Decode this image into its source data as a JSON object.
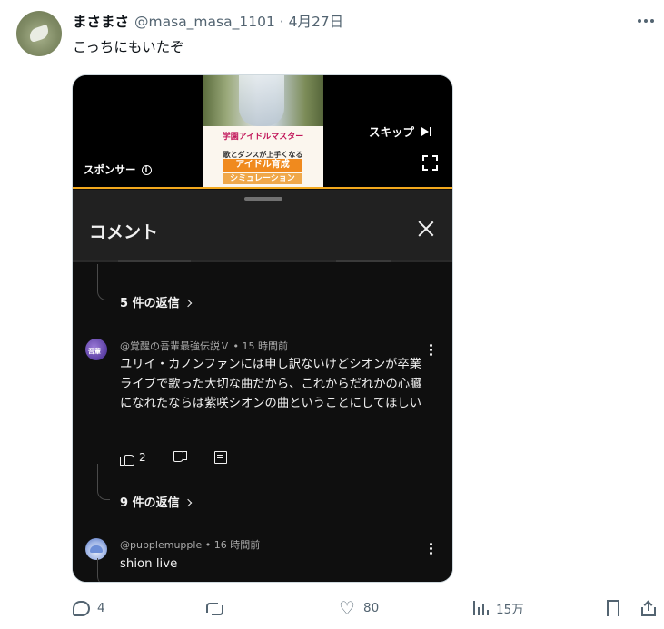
{
  "tweet": {
    "display_name": "まさまさ",
    "handle_and_time": "@masa_masa_1101 · 4月27日",
    "text": "こっちにもいたぞ",
    "avatar_icon": "user-avatar",
    "more_icon": "more-dots-icon"
  },
  "video_ad": {
    "thumbnail_logo": "学園アイドルマスター",
    "thumbnail_line1": "歌とダンスが上手くなる",
    "thumbnail_line2": "アイドル育成",
    "thumbnail_line3": "シミュレーション",
    "sponsor_label": "スポンサー",
    "sponsor_info_glyph": "i",
    "skip_label": "スキップ",
    "progress_color": "#f2a81d"
  },
  "comments_panel": {
    "title": "コメント",
    "close_icon": "close-icon",
    "thread1_replies": "5 件の返信",
    "comments": [
      {
        "author": "@覚醒の吾輩最強伝説Ｖ",
        "time": "15 時間前",
        "avatar_text": "吾輩",
        "text": "ユリイ・カノンファンには申し訳ないけどシオンが卒業ライブで歌った大切な曲だから、これからだれかの心臓になれたならは紫咲シオンの曲ということにしてほしい",
        "likes": "2",
        "replies": "9 件の返信"
      },
      {
        "author": "@pupplemupple",
        "time": "16 時間前",
        "text": "shion live"
      }
    ],
    "meta_separator": " • "
  },
  "actions": {
    "replies": "4",
    "retweets": "",
    "likes": "80",
    "views": "15万",
    "icons": [
      "reply-icon",
      "retweet-icon",
      "like-icon",
      "views-icon",
      "bookmark-icon",
      "share-icon"
    ]
  },
  "colors": {
    "name": "#0f1419",
    "secondary": "#536471",
    "panel_bg": "#212121",
    "comments_bg": "#0f0f0f"
  }
}
